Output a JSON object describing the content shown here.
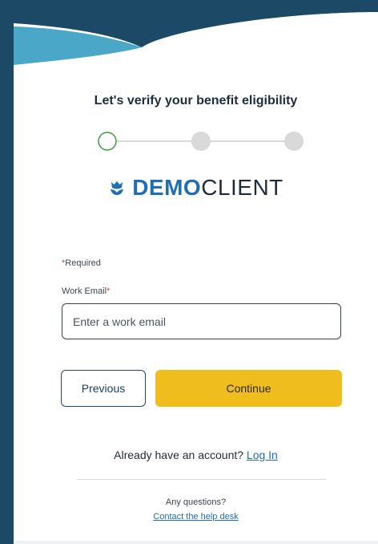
{
  "header": {
    "title": "Let's verify your benefit eligibility"
  },
  "stepper": {
    "steps": 3,
    "current": 1
  },
  "logo": {
    "part1": "DEMO",
    "part2": "CLIENT"
  },
  "form": {
    "required_star": "*",
    "required_text": "Required",
    "email_label": "Work Email",
    "email_star": "*",
    "email_placeholder": "Enter a work email",
    "email_value": ""
  },
  "buttons": {
    "previous": "Previous",
    "continue": "Continue"
  },
  "footer": {
    "account_text": "Already have an account?",
    "login_link": "Log In",
    "questions": "Any questions?",
    "helpdesk_link": "Contact the help desk"
  },
  "colors": {
    "background": "#1c4a66",
    "wave": "#4aa7c8",
    "brand_blue": "#1f6fb6",
    "continue_yellow": "#f0bd1e",
    "step_active": "#3f9b4a",
    "step_inactive": "#d9d9d9"
  }
}
